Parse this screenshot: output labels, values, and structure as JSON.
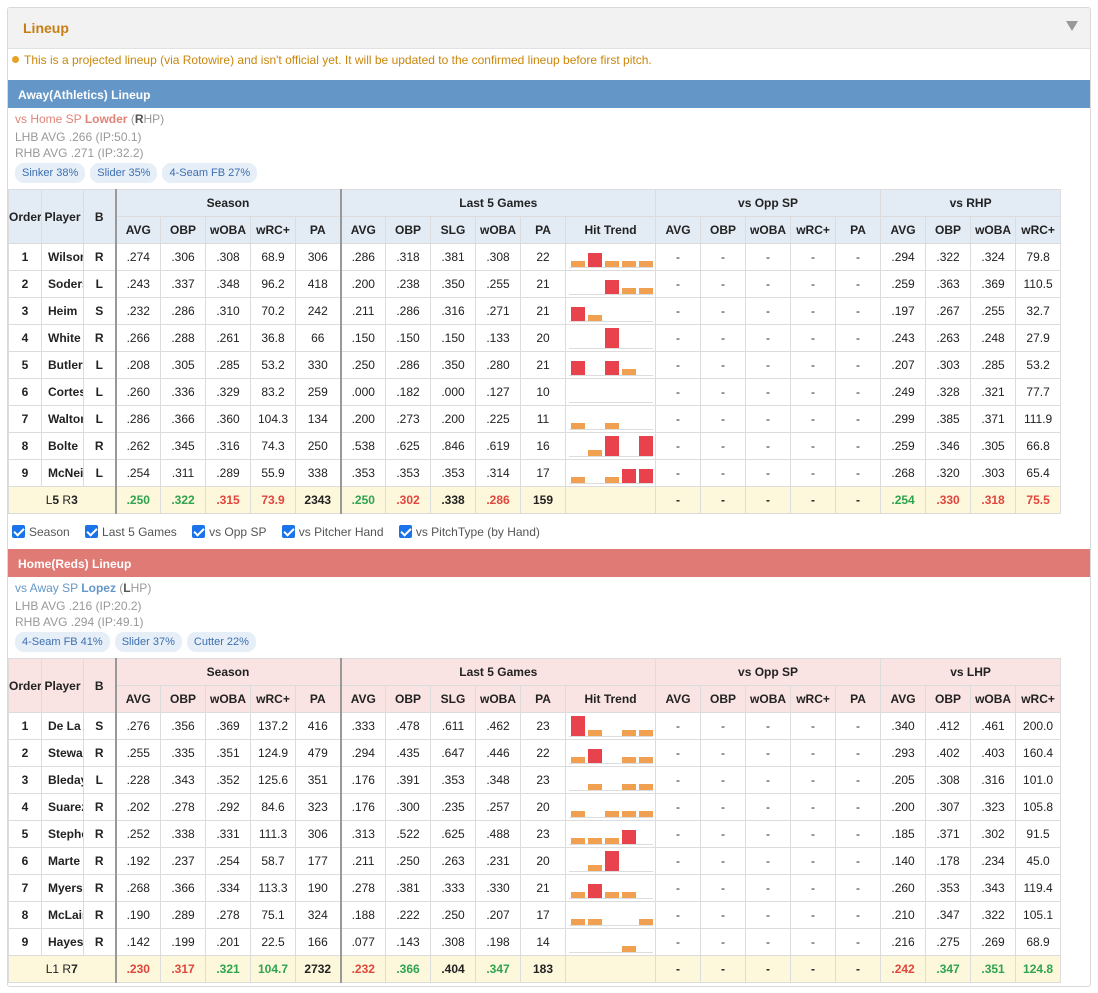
{
  "header": {
    "title": "Lineup"
  },
  "notice": "This is a projected lineup (via Rotowire) and isn't official yet. It will be updated to the confirmed lineup before first pitch.",
  "colors": {
    "away_bar": "#6497c7",
    "home_bar": "#e07a75",
    "away_header": "#e3ebf4",
    "home_header": "#fae3e3",
    "summary_row": "#fdf7dc",
    "positive": "#2ea44f",
    "negative": "#e0463c",
    "trend_orange": "#f0a050",
    "trend_red": "#e8434c"
  },
  "checkboxes": [
    {
      "label": "Season",
      "checked": true
    },
    {
      "label": "Last 5 Games",
      "checked": true
    },
    {
      "label": "vs Opp SP",
      "checked": true
    },
    {
      "label": "vs Pitcher Hand",
      "checked": true
    },
    {
      "label": "vs PitchType (by Hand)",
      "checked": true
    }
  ],
  "away": {
    "title": "Away(Athletics) Lineup",
    "sp": {
      "prefix": "vs Home SP",
      "name": "Lowder",
      "hand_letter": "R",
      "hand_rest": "HP",
      "lhb": "LHB AVG .266 (IP:50.1)",
      "rhb": "RHB AVG .271 (IP:32.2)"
    },
    "pitches": [
      "Sinker 38%",
      "Slider 35%",
      "4-Seam FB 27%"
    ],
    "groups": {
      "season": "Season",
      "last5": "Last 5 Games",
      "opp": "vs Opp SP",
      "hand": "vs RHP"
    },
    "cols": {
      "order": "Order",
      "player": "Player",
      "bat": "B",
      "avg": "AVG",
      "obp": "OBP",
      "woba": "wOBA",
      "wrc": "wRC+",
      "pa": "PA",
      "slg": "SLG",
      "trend": "Hit Trend"
    },
    "rows": [
      {
        "o": "1",
        "n": "Wilson",
        "b": "R",
        "s": [
          ".274",
          ".306",
          ".308",
          "68.9",
          "306"
        ],
        "l5": [
          ".286",
          ".318",
          ".381",
          ".308",
          "22"
        ],
        "t": [
          1,
          2,
          1,
          1,
          1
        ],
        "opp": [
          "-",
          "-",
          "-",
          "-",
          "-"
        ],
        "h": [
          ".294",
          ".322",
          ".324",
          "79.8"
        ]
      },
      {
        "o": "2",
        "n": "Soderstrom",
        "b": "L",
        "s": [
          ".243",
          ".337",
          ".348",
          "96.2",
          "418"
        ],
        "l5": [
          ".200",
          ".238",
          ".350",
          ".255",
          "21"
        ],
        "t": [
          0,
          0,
          2,
          1,
          1
        ],
        "opp": [
          "-",
          "-",
          "-",
          "-",
          "-"
        ],
        "h": [
          ".259",
          ".363",
          ".369",
          "110.5"
        ]
      },
      {
        "o": "3",
        "n": "Heim",
        "b": "S",
        "s": [
          ".232",
          ".286",
          ".310",
          "70.2",
          "242"
        ],
        "l5": [
          ".211",
          ".286",
          ".316",
          ".271",
          "21"
        ],
        "t": [
          2,
          1,
          0,
          0,
          0
        ],
        "opp": [
          "-",
          "-",
          "-",
          "-",
          "-"
        ],
        "h": [
          ".197",
          ".267",
          ".255",
          "32.7"
        ]
      },
      {
        "o": "4",
        "n": "White",
        "b": "R",
        "s": [
          ".266",
          ".288",
          ".261",
          "36.8",
          "66"
        ],
        "l5": [
          ".150",
          ".150",
          ".150",
          ".133",
          "20"
        ],
        "t": [
          0,
          0,
          3,
          0,
          0
        ],
        "opp": [
          "-",
          "-",
          "-",
          "-",
          "-"
        ],
        "h": [
          ".243",
          ".263",
          ".248",
          "27.9"
        ]
      },
      {
        "o": "5",
        "n": "Butler",
        "b": "L",
        "s": [
          ".208",
          ".305",
          ".285",
          "53.2",
          "330"
        ],
        "l5": [
          ".250",
          ".286",
          ".350",
          ".280",
          "21"
        ],
        "t": [
          2,
          0,
          2,
          1,
          0
        ],
        "opp": [
          "-",
          "-",
          "-",
          "-",
          "-"
        ],
        "h": [
          ".207",
          ".303",
          ".285",
          "53.2"
        ]
      },
      {
        "o": "6",
        "n": "Cortes",
        "b": "L",
        "s": [
          ".260",
          ".336",
          ".329",
          "83.2",
          "259"
        ],
        "l5": [
          ".000",
          ".182",
          ".000",
          ".127",
          "10"
        ],
        "t": [
          0,
          0,
          0,
          0,
          0
        ],
        "opp": [
          "-",
          "-",
          "-",
          "-",
          "-"
        ],
        "h": [
          ".249",
          ".328",
          ".321",
          "77.7"
        ]
      },
      {
        "o": "7",
        "n": "Walton",
        "b": "L",
        "s": [
          ".286",
          ".366",
          ".360",
          "104.3",
          "134"
        ],
        "l5": [
          ".200",
          ".273",
          ".200",
          ".225",
          "11"
        ],
        "t": [
          1,
          0,
          1,
          0,
          0
        ],
        "opp": [
          "-",
          "-",
          "-",
          "-",
          "-"
        ],
        "h": [
          ".299",
          ".385",
          ".371",
          "111.9"
        ]
      },
      {
        "o": "8",
        "n": "Bolte",
        "b": "R",
        "s": [
          ".262",
          ".345",
          ".316",
          "74.3",
          "250"
        ],
        "l5": [
          ".538",
          ".625",
          ".846",
          ".619",
          "16"
        ],
        "t": [
          0,
          1,
          3,
          0,
          3
        ],
        "opp": [
          "-",
          "-",
          "-",
          "-",
          "-"
        ],
        "h": [
          ".259",
          ".346",
          ".305",
          "66.8"
        ]
      },
      {
        "o": "9",
        "n": "McNeil",
        "b": "L",
        "s": [
          ".254",
          ".311",
          ".289",
          "55.9",
          "338"
        ],
        "l5": [
          ".353",
          ".353",
          ".353",
          ".314",
          "17"
        ],
        "t": [
          1,
          0,
          1,
          2,
          2
        ],
        "opp": [
          "-",
          "-",
          "-",
          "-",
          "-"
        ],
        "h": [
          ".268",
          ".320",
          ".303",
          "65.4"
        ]
      }
    ],
    "summary": {
      "pre": "L",
      "bold": "5",
      "mid": " R",
      "bold2": "3",
      "s": [
        ".250",
        ".322",
        ".315",
        "73.9",
        "2343"
      ],
      "s_c": [
        "grn",
        "grn",
        "red",
        "red",
        "blk"
      ],
      "l5": [
        ".250",
        ".302",
        ".338",
        ".286",
        "159"
      ],
      "l5_c": [
        "grn",
        "red",
        "blk",
        "red",
        "blk"
      ],
      "opp": [
        "-",
        "-",
        "-",
        "-",
        "-"
      ],
      "h": [
        ".254",
        ".330",
        ".318",
        "75.5"
      ],
      "h_c": [
        "grn",
        "red",
        "red",
        "red"
      ]
    }
  },
  "home": {
    "title": "Home(Reds) Lineup",
    "sp": {
      "prefix": "vs Away SP",
      "name": "Lopez",
      "hand_letter": "L",
      "hand_rest": "HP",
      "lhb": "LHB AVG .216 (IP:20.2)",
      "rhb": "RHB AVG .294 (IP:49.1)"
    },
    "pitches": [
      "4-Seam FB 41%",
      "Slider 37%",
      "Cutter 22%"
    ],
    "groups": {
      "season": "Season",
      "last5": "Last 5 Games",
      "opp": "vs Opp SP",
      "hand": "vs LHP"
    },
    "cols": {
      "order": "Order",
      "player": "Player",
      "bat": "B",
      "avg": "AVG",
      "obp": "OBP",
      "woba": "wOBA",
      "wrc": "wRC+",
      "pa": "PA",
      "slg": "SLG",
      "trend": "Hit Trend"
    },
    "rows": [
      {
        "o": "1",
        "n": "De La Cruz",
        "b": "S",
        "s": [
          ".276",
          ".356",
          ".369",
          "137.2",
          "416"
        ],
        "l5": [
          ".333",
          ".478",
          ".611",
          ".462",
          "23"
        ],
        "t": [
          3,
          1,
          0,
          1,
          1
        ],
        "opp": [
          "-",
          "-",
          "-",
          "-",
          "-"
        ],
        "h": [
          ".340",
          ".412",
          ".461",
          "200.0"
        ]
      },
      {
        "o": "2",
        "n": "Stewart",
        "b": "R",
        "s": [
          ".255",
          ".335",
          ".351",
          "124.9",
          "479"
        ],
        "l5": [
          ".294",
          ".435",
          ".647",
          ".446",
          "22"
        ],
        "t": [
          1,
          2,
          0,
          1,
          1
        ],
        "opp": [
          "-",
          "-",
          "-",
          "-",
          "-"
        ],
        "h": [
          ".293",
          ".402",
          ".403",
          "160.4"
        ]
      },
      {
        "o": "3",
        "n": "Bleday",
        "b": "L",
        "s": [
          ".228",
          ".343",
          ".352",
          "125.6",
          "351"
        ],
        "l5": [
          ".176",
          ".391",
          ".353",
          ".348",
          "23"
        ],
        "t": [
          0,
          1,
          0,
          1,
          1
        ],
        "opp": [
          "-",
          "-",
          "-",
          "-",
          "-"
        ],
        "h": [
          ".205",
          ".308",
          ".316",
          "101.0"
        ]
      },
      {
        "o": "4",
        "n": "Suarez",
        "b": "R",
        "s": [
          ".202",
          ".278",
          ".292",
          "84.6",
          "323"
        ],
        "l5": [
          ".176",
          ".300",
          ".235",
          ".257",
          "20"
        ],
        "t": [
          1,
          0,
          1,
          1,
          1
        ],
        "opp": [
          "-",
          "-",
          "-",
          "-",
          "-"
        ],
        "h": [
          ".200",
          ".307",
          ".323",
          "105.8"
        ]
      },
      {
        "o": "5",
        "n": "Stephenson",
        "b": "R",
        "s": [
          ".252",
          ".338",
          ".331",
          "111.3",
          "306"
        ],
        "l5": [
          ".313",
          ".522",
          ".625",
          ".488",
          "23"
        ],
        "t": [
          1,
          1,
          1,
          2,
          0
        ],
        "opp": [
          "-",
          "-",
          "-",
          "-",
          "-"
        ],
        "h": [
          ".185",
          ".371",
          ".302",
          "91.5"
        ]
      },
      {
        "o": "6",
        "n": "Marte",
        "b": "R",
        "s": [
          ".192",
          ".237",
          ".254",
          "58.7",
          "177"
        ],
        "l5": [
          ".211",
          ".250",
          ".263",
          ".231",
          "20"
        ],
        "t": [
          0,
          1,
          3,
          0,
          0
        ],
        "opp": [
          "-",
          "-",
          "-",
          "-",
          "-"
        ],
        "h": [
          ".140",
          ".178",
          ".234",
          "45.0"
        ]
      },
      {
        "o": "7",
        "n": "Myers",
        "b": "R",
        "s": [
          ".268",
          ".366",
          ".334",
          "113.3",
          "190"
        ],
        "l5": [
          ".278",
          ".381",
          ".333",
          ".330",
          "21"
        ],
        "t": [
          1,
          2,
          1,
          1,
          0
        ],
        "opp": [
          "-",
          "-",
          "-",
          "-",
          "-"
        ],
        "h": [
          ".260",
          ".353",
          ".343",
          "119.4"
        ]
      },
      {
        "o": "8",
        "n": "McLain",
        "b": "R",
        "s": [
          ".190",
          ".289",
          ".278",
          "75.1",
          "324"
        ],
        "l5": [
          ".188",
          ".222",
          ".250",
          ".207",
          "17"
        ],
        "t": [
          1,
          1,
          0,
          0,
          1
        ],
        "opp": [
          "-",
          "-",
          "-",
          "-",
          "-"
        ],
        "h": [
          ".210",
          ".347",
          ".322",
          "105.1"
        ]
      },
      {
        "o": "9",
        "n": "Hayes",
        "b": "R",
        "s": [
          ".142",
          ".199",
          ".201",
          "22.5",
          "166"
        ],
        "l5": [
          ".077",
          ".143",
          ".308",
          ".198",
          "14"
        ],
        "t": [
          0,
          0,
          0,
          1,
          0
        ],
        "opp": [
          "-",
          "-",
          "-",
          "-",
          "-"
        ],
        "h": [
          ".216",
          ".275",
          ".269",
          "68.9"
        ]
      }
    ],
    "summary": {
      "pre": "L1 R",
      "bold": "7",
      "mid": "",
      "bold2": "",
      "s": [
        ".230",
        ".317",
        ".321",
        "104.7",
        "2732"
      ],
      "s_c": [
        "red",
        "red",
        "grn",
        "grn",
        "blk"
      ],
      "l5": [
        ".232",
        ".366",
        ".404",
        ".347",
        "183"
      ],
      "l5_c": [
        "red",
        "grn",
        "blk",
        "grn",
        "blk"
      ],
      "opp": [
        "-",
        "-",
        "-",
        "-",
        "-"
      ],
      "h": [
        ".242",
        ".347",
        ".351",
        "124.8"
      ],
      "h_c": [
        "red",
        "grn",
        "grn",
        "grn"
      ]
    }
  }
}
